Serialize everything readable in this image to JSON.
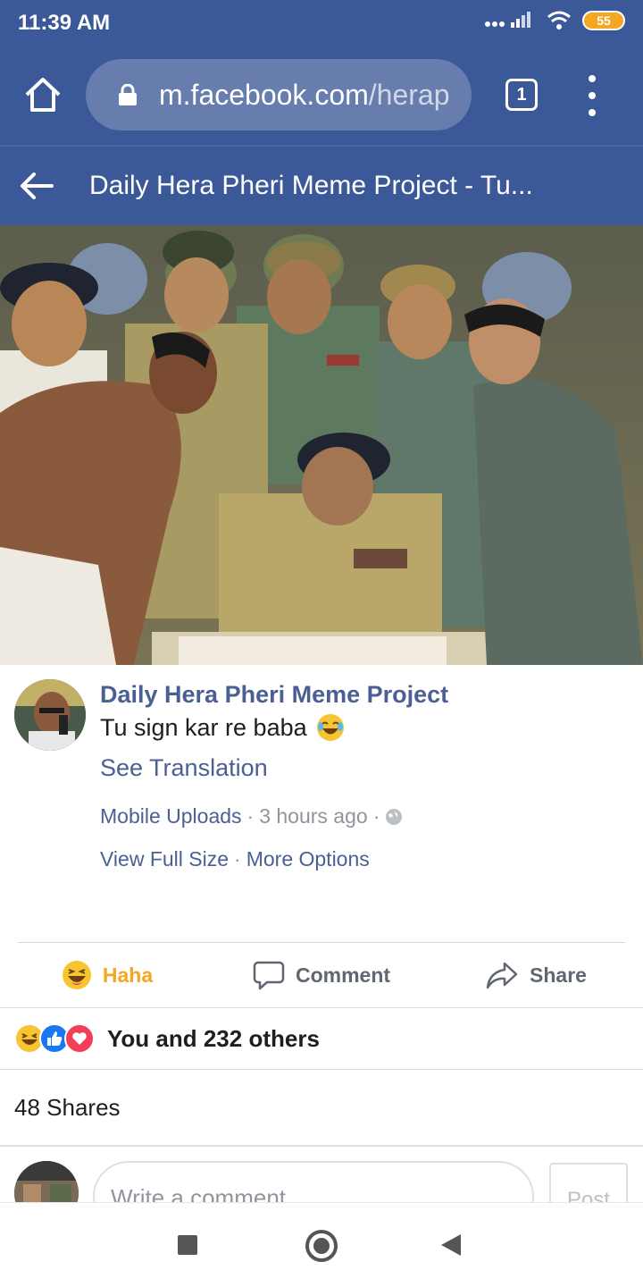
{
  "status_bar": {
    "time": "11:39 AM",
    "battery": "55"
  },
  "browser": {
    "url_main": "m.facebook.com",
    "url_faded": "/herap",
    "tab_count": "1"
  },
  "header": {
    "title": "Daily Hera Pheri Meme Project - Tu..."
  },
  "post": {
    "page_name": "Daily Hera Pheri Meme Project",
    "text": "Tu sign kar re baba",
    "see_translation": "See Translation",
    "source": "Mobile Uploads",
    "time": "3 hours ago",
    "view_full_size": "View Full Size",
    "more_options": "More Options"
  },
  "actions": {
    "haha": "Haha",
    "comment": "Comment",
    "share": "Share"
  },
  "reactions": {
    "summary": "You and 232 others"
  },
  "shares": {
    "count_label": "48 Shares"
  },
  "comment_box": {
    "placeholder": "Write a comment...",
    "post_label": "Post"
  },
  "colors": {
    "facebook_blue": "#3b5998",
    "link_blue": "#4b5f93",
    "haha_yellow": "#f5a623",
    "love_red": "#f33e58",
    "like_blue": "#1877f2"
  },
  "icons": [
    "home-icon",
    "lock-icon",
    "tabs-icon",
    "overflow-menu-icon",
    "back-arrow-icon",
    "globe-icon",
    "haha-icon",
    "comment-icon",
    "share-icon",
    "like-icon",
    "love-icon",
    "recents-icon",
    "home-nav-icon",
    "back-nav-icon"
  ]
}
